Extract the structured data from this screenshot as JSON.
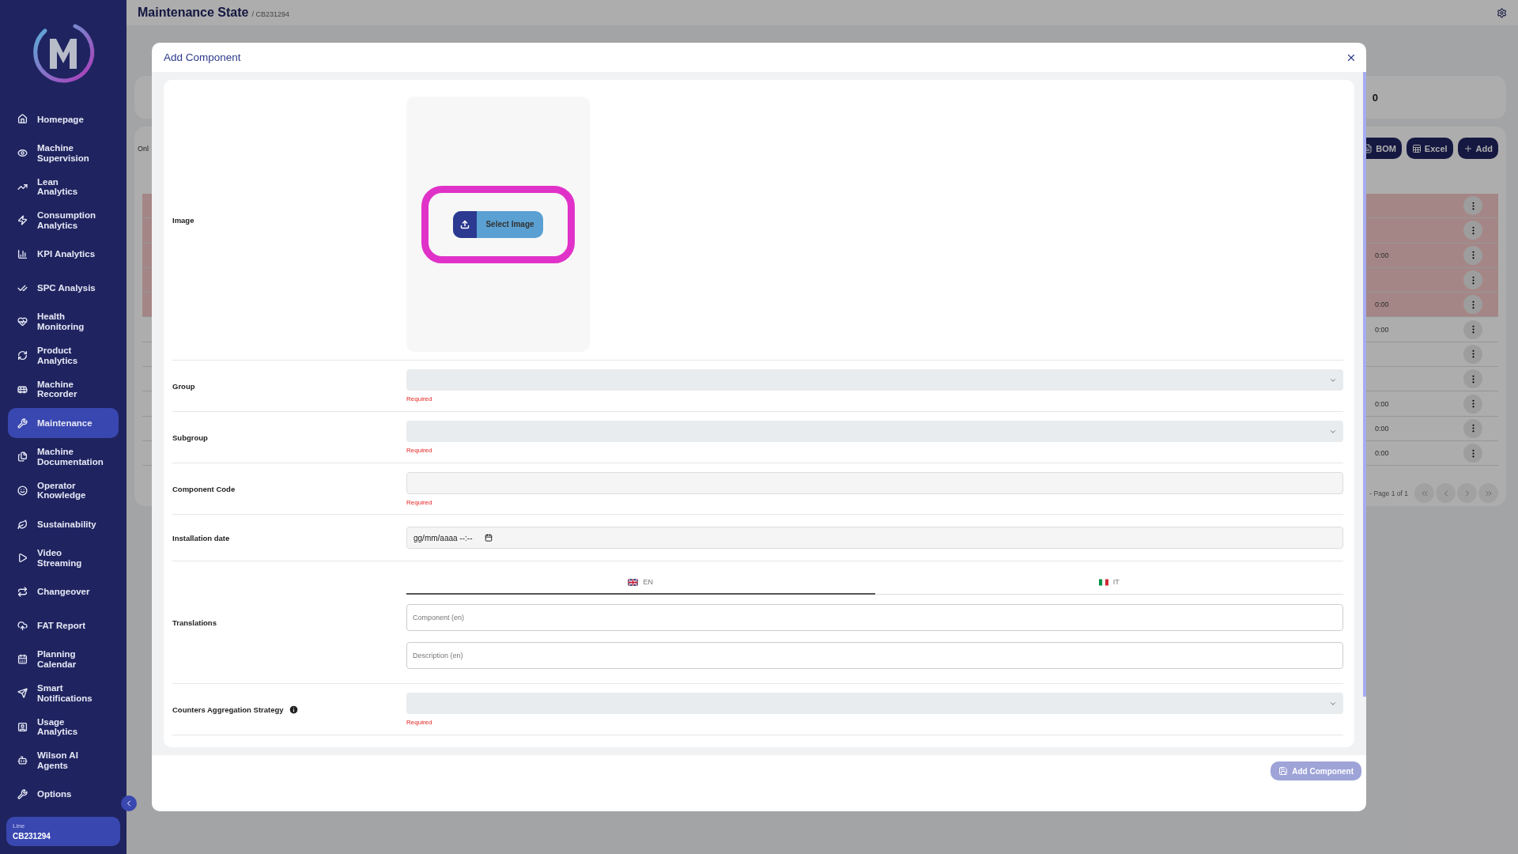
{
  "sidebar": {
    "items": [
      {
        "label": "Homepage",
        "selected": false
      },
      {
        "label": "Machine Supervision",
        "selected": false
      },
      {
        "label": "Lean Analytics",
        "selected": false
      },
      {
        "label": "Consumption Analytics",
        "selected": false
      },
      {
        "label": "KPI Analytics",
        "selected": false
      },
      {
        "label": "SPC Analysis",
        "selected": false
      },
      {
        "label": "Health Monitoring",
        "selected": false
      },
      {
        "label": "Product Analytics",
        "selected": false
      },
      {
        "label": "Machine Recorder",
        "selected": false
      },
      {
        "label": "Maintenance",
        "selected": true
      },
      {
        "label": "Machine Documentation",
        "selected": false
      },
      {
        "label": "Operator Knowledge",
        "selected": false
      },
      {
        "label": "Sustainability",
        "selected": false
      },
      {
        "label": "Video Streaming",
        "selected": false
      },
      {
        "label": "Changeover",
        "selected": false
      },
      {
        "label": "FAT Report",
        "selected": false
      },
      {
        "label": "Planning Calendar",
        "selected": false
      },
      {
        "label": "Smart Notifications",
        "selected": false
      },
      {
        "label": "Usage Analytics",
        "selected": false
      },
      {
        "label": "Wilson AI Agents",
        "selected": false
      },
      {
        "label": "Options",
        "selected": false
      }
    ],
    "line": {
      "label": "Line",
      "value": "CB231294"
    }
  },
  "header": {
    "title": "Maintenance State",
    "subtitle": "/ CB231294"
  },
  "background": {
    "summary_value": "0",
    "filter_text": "Onl",
    "buttons": [
      "BOM",
      "Excel",
      "Add"
    ],
    "rows": [
      {
        "overdue": true
      },
      {
        "overdue": true
      },
      {
        "overdue": true,
        "time": "0:00"
      },
      {
        "overdue": true
      },
      {
        "overdue": true,
        "time": "0:00"
      },
      {
        "overdue": false,
        "time": "0:00"
      },
      {
        "overdue": false
      },
      {
        "overdue": false
      },
      {
        "overdue": false,
        "time": "0:00"
      },
      {
        "overdue": false,
        "time": "0:00"
      },
      {
        "overdue": false,
        "time": "0:00"
      }
    ],
    "pagination": "- Page 1 of 1"
  },
  "modal": {
    "title": "Add Component",
    "image": {
      "label": "Image",
      "button": "Select Image"
    },
    "fields": [
      {
        "kind": "select",
        "label": "Group",
        "error": "Required"
      },
      {
        "kind": "select",
        "label": "Subgroup",
        "error": "Required"
      },
      {
        "kind": "text",
        "label": "Component Code",
        "error": "Required"
      },
      {
        "kind": "datetime",
        "label": "Installation date",
        "value": "gg/mm/aaaa --:--"
      },
      {
        "kind": "translations",
        "label": "Translations",
        "tabs": [
          {
            "label": "EN",
            "selected": true
          },
          {
            "label": "IT",
            "selected": false
          }
        ],
        "placeholders": [
          "Component (en)",
          "Description (en)"
        ]
      },
      {
        "kind": "select",
        "label": "Counters Aggregation Strategy",
        "info": true,
        "error": "Required"
      }
    ],
    "submit": {
      "label": "Add Component",
      "disabled": true
    }
  }
}
